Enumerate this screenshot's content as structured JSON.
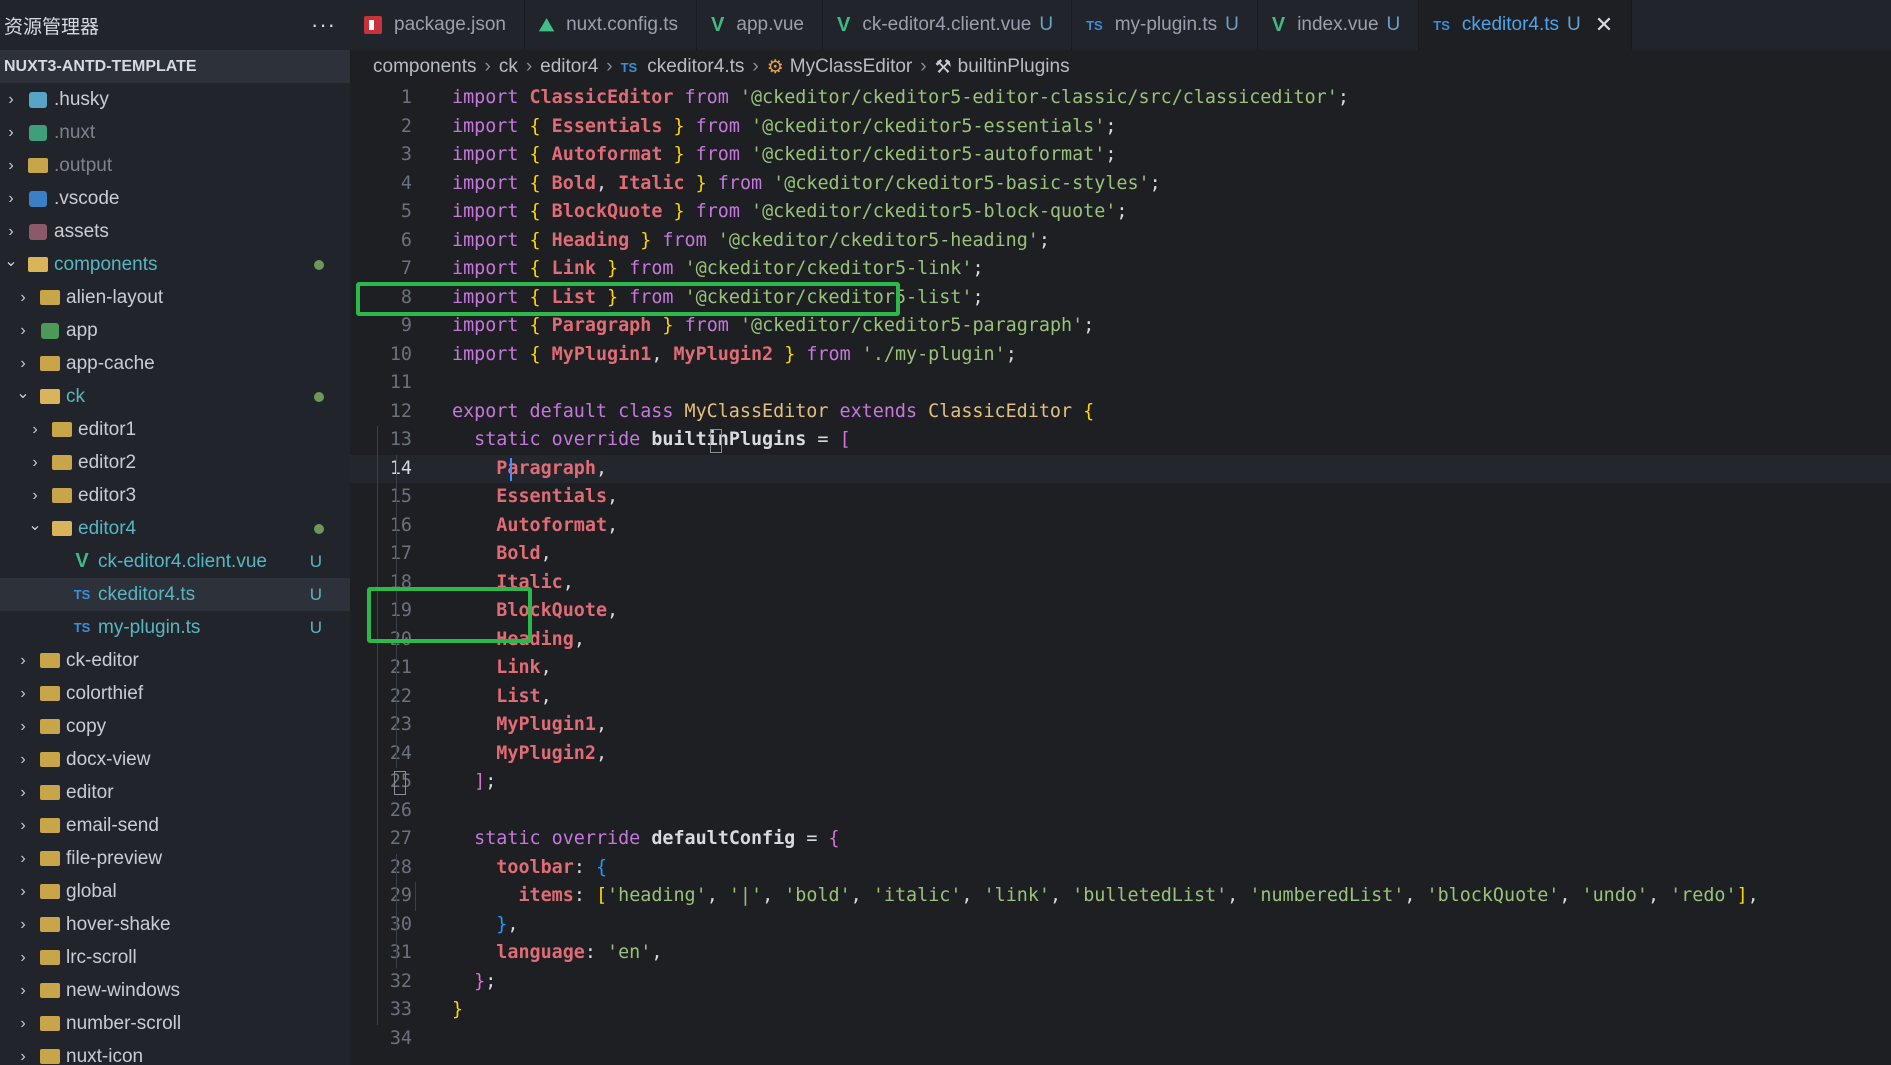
{
  "sidebar": {
    "title": "资源管理器",
    "more": "···",
    "project": "NUXT3-ANTD-TEMPLATE",
    "items": [
      {
        "label": ".husky",
        "depth": 0,
        "expanded": false,
        "icon": "husky-folder-icon",
        "dim": false
      },
      {
        "label": ".nuxt",
        "depth": 0,
        "expanded": false,
        "icon": "nuxt-folder-icon",
        "dim": true
      },
      {
        "label": ".output",
        "depth": 0,
        "expanded": false,
        "icon": "folder-icon",
        "dim": true
      },
      {
        "label": ".vscode",
        "depth": 0,
        "expanded": false,
        "icon": "vscode-folder-icon",
        "dim": false
      },
      {
        "label": "assets",
        "depth": 0,
        "expanded": false,
        "icon": "assets-folder-icon",
        "dim": false
      },
      {
        "label": "components",
        "depth": 0,
        "expanded": true,
        "icon": "folder-open-icon",
        "dim": false,
        "dot": true,
        "color": "#56b6c2"
      },
      {
        "label": "alien-layout",
        "depth": 1,
        "expanded": false,
        "icon": "folder-icon"
      },
      {
        "label": "app",
        "depth": 1,
        "expanded": false,
        "icon": "app-folder-icon"
      },
      {
        "label": "app-cache",
        "depth": 1,
        "expanded": false,
        "icon": "folder-icon"
      },
      {
        "label": "ck",
        "depth": 1,
        "expanded": true,
        "icon": "folder-open-icon",
        "dot": true,
        "color": "#56b6c2"
      },
      {
        "label": "editor1",
        "depth": 2,
        "expanded": false,
        "icon": "folder-icon"
      },
      {
        "label": "editor2",
        "depth": 2,
        "expanded": false,
        "icon": "folder-icon"
      },
      {
        "label": "editor3",
        "depth": 2,
        "expanded": false,
        "icon": "folder-icon"
      },
      {
        "label": "editor4",
        "depth": 2,
        "expanded": true,
        "icon": "folder-open-icon",
        "dot": true,
        "color": "#56b6c2"
      },
      {
        "label": "ck-editor4.client.vue",
        "depth": 3,
        "file": true,
        "icon": "vue-icon",
        "badge": "U",
        "color": "#56b6c2"
      },
      {
        "label": "ckeditor4.ts",
        "depth": 3,
        "file": true,
        "icon": "ts-icon",
        "badge": "U",
        "color": "#56b6c2",
        "selected": true
      },
      {
        "label": "my-plugin.ts",
        "depth": 3,
        "file": true,
        "icon": "ts-icon",
        "badge": "U",
        "color": "#56b6c2"
      },
      {
        "label": "ck-editor",
        "depth": 1,
        "expanded": false,
        "icon": "folder-icon"
      },
      {
        "label": "colorthief",
        "depth": 1,
        "expanded": false,
        "icon": "folder-icon"
      },
      {
        "label": "copy",
        "depth": 1,
        "expanded": false,
        "icon": "folder-icon"
      },
      {
        "label": "docx-view",
        "depth": 1,
        "expanded": false,
        "icon": "folder-icon"
      },
      {
        "label": "editor",
        "depth": 1,
        "expanded": false,
        "icon": "folder-icon"
      },
      {
        "label": "email-send",
        "depth": 1,
        "expanded": false,
        "icon": "folder-icon"
      },
      {
        "label": "file-preview",
        "depth": 1,
        "expanded": false,
        "icon": "folder-icon"
      },
      {
        "label": "global",
        "depth": 1,
        "expanded": false,
        "icon": "folder-icon"
      },
      {
        "label": "hover-shake",
        "depth": 1,
        "expanded": false,
        "icon": "folder-icon"
      },
      {
        "label": "lrc-scroll",
        "depth": 1,
        "expanded": false,
        "icon": "folder-icon"
      },
      {
        "label": "new-windows",
        "depth": 1,
        "expanded": false,
        "icon": "folder-icon"
      },
      {
        "label": "number-scroll",
        "depth": 1,
        "expanded": false,
        "icon": "folder-icon"
      },
      {
        "label": "nuxt-icon",
        "depth": 1,
        "expanded": false,
        "icon": "folder-icon"
      }
    ]
  },
  "tabs": [
    {
      "label": "package.json",
      "icon": "npm-icon",
      "modified": "",
      "active": false
    },
    {
      "label": "nuxt.config.ts",
      "icon": "nuxt-icon",
      "modified": "",
      "active": false
    },
    {
      "label": "app.vue",
      "icon": "vue-icon",
      "modified": "",
      "active": false
    },
    {
      "label": "ck-editor4.client.vue",
      "icon": "vue-icon",
      "modified": "U",
      "active": false
    },
    {
      "label": "my-plugin.ts",
      "icon": "ts-icon",
      "modified": "U",
      "active": false
    },
    {
      "label": "index.vue",
      "icon": "vue-icon",
      "modified": "U",
      "active": false
    },
    {
      "label": "ckeditor4.ts",
      "icon": "ts-icon",
      "modified": "U",
      "active": true,
      "close": "✕"
    }
  ],
  "breadcrumb": {
    "parts": [
      "components",
      "ck",
      "editor4"
    ],
    "file": "ckeditor4.ts",
    "file_icon": "TS",
    "class": "MyClassEditor",
    "member": "builtinPlugins"
  },
  "editor": {
    "current_line": 14,
    "lines": [
      [
        [
          "kw",
          "import "
        ],
        [
          "id",
          "ClassicEditor "
        ],
        [
          "kw",
          "from "
        ],
        [
          "str",
          "'@ckeditor/ckeditor5-editor-classic/src/classiceditor'"
        ],
        [
          "pl",
          ";"
        ]
      ],
      [
        [
          "kw",
          "import "
        ],
        [
          "brace1",
          "{ "
        ],
        [
          "id",
          "Essentials "
        ],
        [
          "brace1",
          "} "
        ],
        [
          "kw",
          "from "
        ],
        [
          "str",
          "'@ckeditor/ckeditor5-essentials'"
        ],
        [
          "pl",
          ";"
        ]
      ],
      [
        [
          "kw",
          "import "
        ],
        [
          "brace1",
          "{ "
        ],
        [
          "id",
          "Autoformat "
        ],
        [
          "brace1",
          "} "
        ],
        [
          "kw",
          "from "
        ],
        [
          "str",
          "'@ckeditor/ckeditor5-autoformat'"
        ],
        [
          "pl",
          ";"
        ]
      ],
      [
        [
          "kw",
          "import "
        ],
        [
          "brace1",
          "{ "
        ],
        [
          "id",
          "Bold"
        ],
        [
          "pl",
          ", "
        ],
        [
          "id",
          "Italic "
        ],
        [
          "brace1",
          "} "
        ],
        [
          "kw",
          "from "
        ],
        [
          "str",
          "'@ckeditor/ckeditor5-basic-styles'"
        ],
        [
          "pl",
          ";"
        ]
      ],
      [
        [
          "kw",
          "import "
        ],
        [
          "brace1",
          "{ "
        ],
        [
          "id",
          "BlockQuote "
        ],
        [
          "brace1",
          "} "
        ],
        [
          "kw",
          "from "
        ],
        [
          "str",
          "'@ckeditor/ckeditor5-block-quote'"
        ],
        [
          "pl",
          ";"
        ]
      ],
      [
        [
          "kw",
          "import "
        ],
        [
          "brace1",
          "{ "
        ],
        [
          "id",
          "Heading "
        ],
        [
          "brace1",
          "} "
        ],
        [
          "kw",
          "from "
        ],
        [
          "str",
          "'@ckeditor/ckeditor5-heading'"
        ],
        [
          "pl",
          ";"
        ]
      ],
      [
        [
          "kw",
          "import "
        ],
        [
          "brace1",
          "{ "
        ],
        [
          "id",
          "Link "
        ],
        [
          "brace1",
          "} "
        ],
        [
          "kw",
          "from "
        ],
        [
          "str",
          "'@ckeditor/ckeditor5-link'"
        ],
        [
          "pl",
          ";"
        ]
      ],
      [
        [
          "kw",
          "import "
        ],
        [
          "brace1",
          "{ "
        ],
        [
          "id",
          "List "
        ],
        [
          "brace1",
          "} "
        ],
        [
          "kw",
          "from "
        ],
        [
          "str",
          "'@ckeditor/ckeditor5-list'"
        ],
        [
          "pl",
          ";"
        ]
      ],
      [
        [
          "kw",
          "import "
        ],
        [
          "brace1",
          "{ "
        ],
        [
          "id",
          "Paragraph "
        ],
        [
          "brace1",
          "} "
        ],
        [
          "kw",
          "from "
        ],
        [
          "str",
          "'@ckeditor/ckeditor5-paragraph'"
        ],
        [
          "pl",
          ";"
        ]
      ],
      [
        [
          "kw",
          "import "
        ],
        [
          "brace1",
          "{ "
        ],
        [
          "id",
          "MyPlugin1"
        ],
        [
          "pl",
          ", "
        ],
        [
          "id",
          "MyPlugin2 "
        ],
        [
          "brace1",
          "} "
        ],
        [
          "kw",
          "from "
        ],
        [
          "str",
          "'./my-plugin'"
        ],
        [
          "pl",
          ";"
        ]
      ],
      [],
      [
        [
          "kw",
          "export default class "
        ],
        [
          "cls",
          "MyClassEditor "
        ],
        [
          "kw",
          "extends "
        ],
        [
          "cls",
          "ClassicEditor "
        ],
        [
          "brace1",
          "{"
        ]
      ],
      [
        [
          "pl",
          "  "
        ],
        [
          "kw",
          "static override "
        ],
        [
          "fn",
          "builtinPlugins "
        ],
        [
          "pl",
          "= "
        ],
        [
          "brace2",
          "["
        ]
      ],
      [
        [
          "pl",
          "    "
        ],
        [
          "id",
          "Paragraph"
        ],
        [
          "pl",
          ","
        ]
      ],
      [
        [
          "pl",
          "    "
        ],
        [
          "id",
          "Essentials"
        ],
        [
          "pl",
          ","
        ]
      ],
      [
        [
          "pl",
          "    "
        ],
        [
          "id",
          "Autoformat"
        ],
        [
          "pl",
          ","
        ]
      ],
      [
        [
          "pl",
          "    "
        ],
        [
          "id",
          "Bold"
        ],
        [
          "pl",
          ","
        ]
      ],
      [
        [
          "pl",
          "    "
        ],
        [
          "id",
          "Italic"
        ],
        [
          "pl",
          ","
        ]
      ],
      [
        [
          "pl",
          "    "
        ],
        [
          "id",
          "BlockQuote"
        ],
        [
          "pl",
          ","
        ]
      ],
      [
        [
          "pl",
          "    "
        ],
        [
          "id",
          "Heading"
        ],
        [
          "pl",
          ","
        ]
      ],
      [
        [
          "pl",
          "    "
        ],
        [
          "id",
          "Link"
        ],
        [
          "pl",
          ","
        ]
      ],
      [
        [
          "pl",
          "    "
        ],
        [
          "id",
          "List"
        ],
        [
          "pl",
          ","
        ]
      ],
      [
        [
          "pl",
          "    "
        ],
        [
          "id",
          "MyPlugin1"
        ],
        [
          "pl",
          ","
        ]
      ],
      [
        [
          "pl",
          "    "
        ],
        [
          "id",
          "MyPlugin2"
        ],
        [
          "pl",
          ","
        ]
      ],
      [
        [
          "pl",
          "  "
        ],
        [
          "brace2",
          "]"
        ],
        [
          "pl",
          ";"
        ]
      ],
      [],
      [
        [
          "pl",
          "  "
        ],
        [
          "kw",
          "static override "
        ],
        [
          "fn",
          "defaultConfig "
        ],
        [
          "pl",
          "= "
        ],
        [
          "brace2",
          "{"
        ]
      ],
      [
        [
          "pl",
          "    "
        ],
        [
          "prop",
          "toolbar"
        ],
        [
          "pl",
          ": "
        ],
        [
          "brace3",
          "{"
        ]
      ],
      [
        [
          "pl",
          "      "
        ],
        [
          "prop",
          "items"
        ],
        [
          "pl",
          ": "
        ],
        [
          "brace1",
          "["
        ],
        [
          "str",
          "'heading'"
        ],
        [
          "pl",
          ", "
        ],
        [
          "str",
          "'|'"
        ],
        [
          "pl",
          ", "
        ],
        [
          "str",
          "'bold'"
        ],
        [
          "pl",
          ", "
        ],
        [
          "str",
          "'italic'"
        ],
        [
          "pl",
          ", "
        ],
        [
          "str",
          "'link'"
        ],
        [
          "pl",
          ", "
        ],
        [
          "str",
          "'bulletedList'"
        ],
        [
          "pl",
          ", "
        ],
        [
          "str",
          "'numberedList'"
        ],
        [
          "pl",
          ", "
        ],
        [
          "str",
          "'blockQuote'"
        ],
        [
          "pl",
          ", "
        ],
        [
          "str",
          "'undo'"
        ],
        [
          "pl",
          ", "
        ],
        [
          "str",
          "'redo'"
        ],
        [
          "brace1",
          "]"
        ],
        [
          "pl",
          ","
        ]
      ],
      [
        [
          "pl",
          "    "
        ],
        [
          "brace3",
          "}"
        ],
        [
          "pl",
          ","
        ]
      ],
      [
        [
          "pl",
          "    "
        ],
        [
          "prop",
          "language"
        ],
        [
          "pl",
          ": "
        ],
        [
          "str",
          "'en'"
        ],
        [
          "pl",
          ","
        ]
      ],
      [
        [
          "pl",
          "  "
        ],
        [
          "brace2",
          "}"
        ],
        [
          "pl",
          ";"
        ]
      ],
      [
        [
          "brace1",
          "}"
        ]
      ],
      []
    ]
  },
  "colors": {
    "highlight_box": "#2db84a",
    "active_tab_text": "#4ea3e8"
  }
}
